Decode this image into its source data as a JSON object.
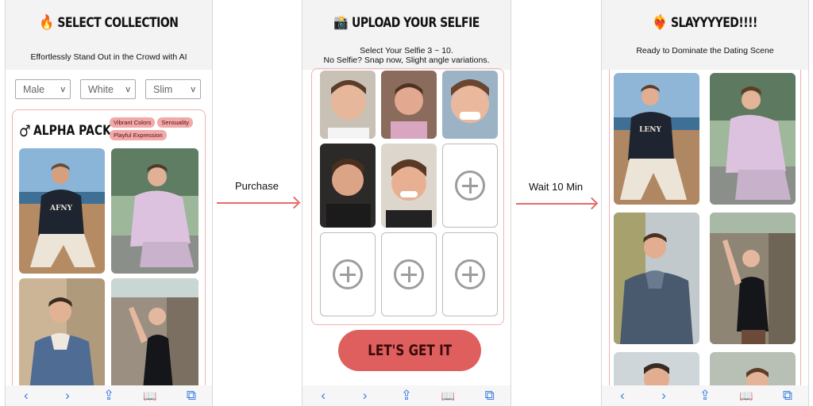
{
  "panel1": {
    "title_emoji": "🔥",
    "title": "SELECT COLLECTION",
    "subtitle": "Effortlessly Stand Out in the Crowd with AI",
    "filters": [
      {
        "value": "Male",
        "caret": "v"
      },
      {
        "value": "White",
        "caret": "v"
      },
      {
        "value": "Slim",
        "caret": "v"
      }
    ],
    "pack": {
      "icon": "♂",
      "name": "ALPHA PACK",
      "tags": [
        "Vibrant Colors",
        "Sensuality",
        "Playful Expression"
      ],
      "photo_shirt_text": "AFNY"
    }
  },
  "arrow1": {
    "label": "Purchase"
  },
  "panel2": {
    "title_emoji": "📸",
    "title": "UPLOAD YOUR SELFIE",
    "subtitle_line1": "Select Your Selfie 3 ~ 10.",
    "subtitle_line2": "No Selfie? Snap now, Slight angle variations.",
    "cta": "LET'S GET IT"
  },
  "arrow2": {
    "label": "Wait 10 Min"
  },
  "panel3": {
    "title_emoji": "❤️‍🔥",
    "title": "SLAYYYYED!!!!",
    "subtitle": "Ready to Dominate the Dating Scene",
    "photo_shirt_text": "LENY"
  },
  "toolbar": {
    "back": "‹",
    "forward": "›",
    "share": "⇪",
    "bookmarks": "📖",
    "tabs": "⧉"
  },
  "colors": {
    "accent": "#df5f5f",
    "border_pink": "#efb2b2",
    "tag_pink": "#f2a9a8",
    "toolbar_blue": "#3b7ee6"
  }
}
